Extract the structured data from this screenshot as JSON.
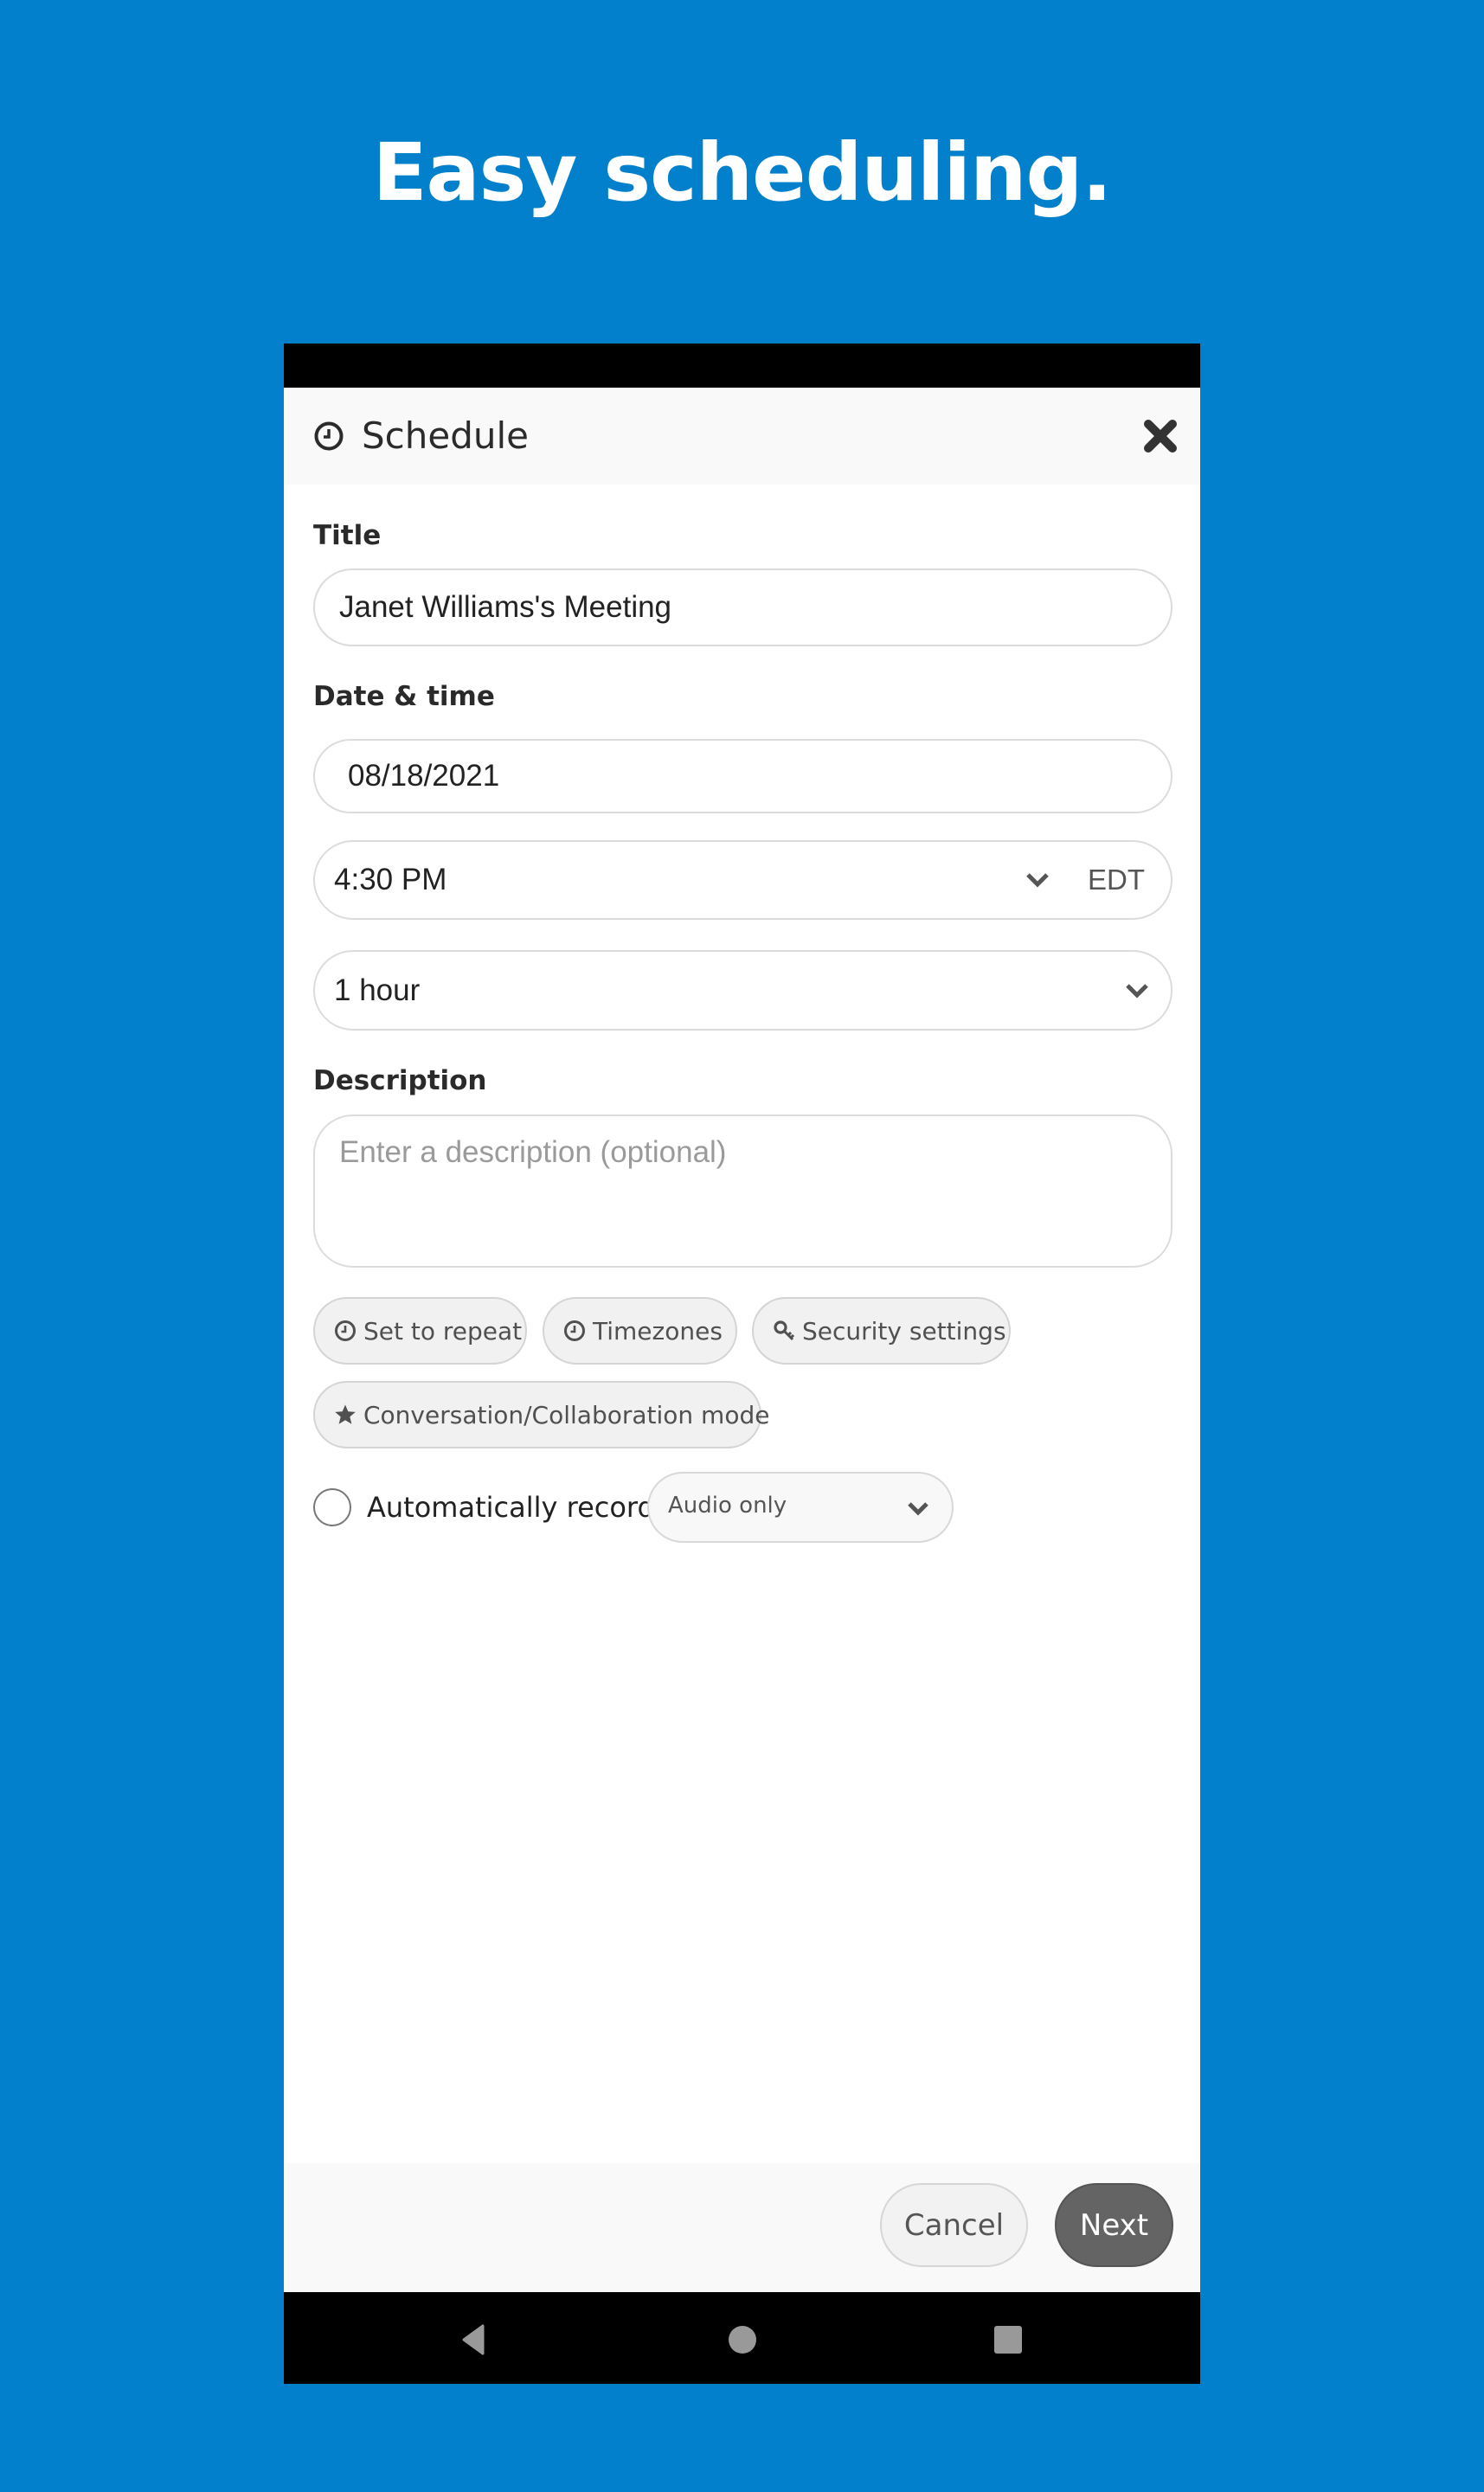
{
  "headline": "Easy scheduling.",
  "dialog": {
    "title": "Schedule",
    "icon": "clock-icon",
    "close_icon": "close-icon"
  },
  "form": {
    "title_label": "Title",
    "title_value": "Janet Williams's Meeting",
    "datetime_label": "Date & time",
    "date_value": "08/18/2021",
    "time_value": "4:30 PM",
    "timezone_abbr": "EDT",
    "duration_value": "1 hour",
    "description_label": "Description",
    "description_placeholder": "Enter a description (optional)"
  },
  "options": [
    {
      "label": "Set to repeat",
      "icon": "clock-icon"
    },
    {
      "label": "Timezones",
      "icon": "clock-icon"
    },
    {
      "label": "Security settings",
      "icon": "key-icon"
    },
    {
      "label": "Conversation/Collaboration mode",
      "icon": "star-icon"
    }
  ],
  "record": {
    "label": "Automatically record",
    "checked": false,
    "mode_value": "Audio only"
  },
  "footer": {
    "cancel_label": "Cancel",
    "next_label": "Next"
  },
  "system_nav": {
    "back_icon": "back-triangle-icon",
    "home_icon": "home-circle-icon",
    "recents_icon": "recents-square-icon"
  },
  "colors": {
    "background": "#0280CB",
    "primary_button": "#646464",
    "chip_background": "#F1F1F1"
  }
}
